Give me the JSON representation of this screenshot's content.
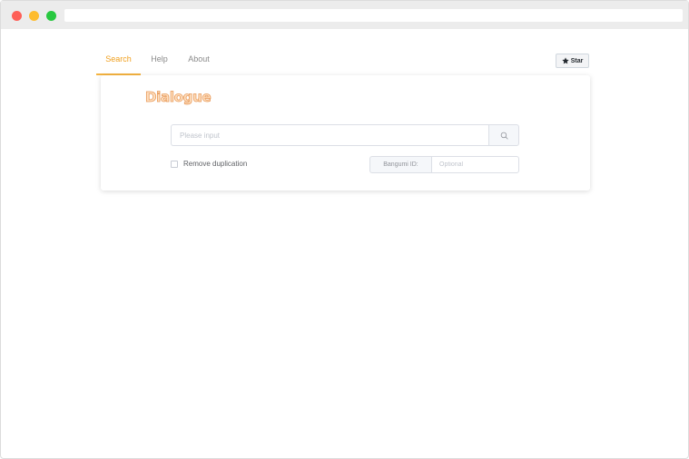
{
  "nav": {
    "tabs": [
      {
        "label": "Search",
        "active": true
      },
      {
        "label": "Help",
        "active": false
      },
      {
        "label": "About",
        "active": false
      }
    ]
  },
  "star_button": {
    "label": "Star",
    "icon": "star-icon"
  },
  "card": {
    "title": "Dialogue",
    "search": {
      "value": "",
      "placeholder": "Please input",
      "button_icon": "search-icon"
    },
    "remove_duplication": {
      "label": "Remove duplication",
      "checked": false
    },
    "bangumi": {
      "label": "Bangumi ID:",
      "value": "",
      "placeholder": "Optional"
    }
  },
  "colors": {
    "accent": "#f5b441",
    "title_fill": "#ffe0c0",
    "title_stroke": "#e89a5a"
  }
}
